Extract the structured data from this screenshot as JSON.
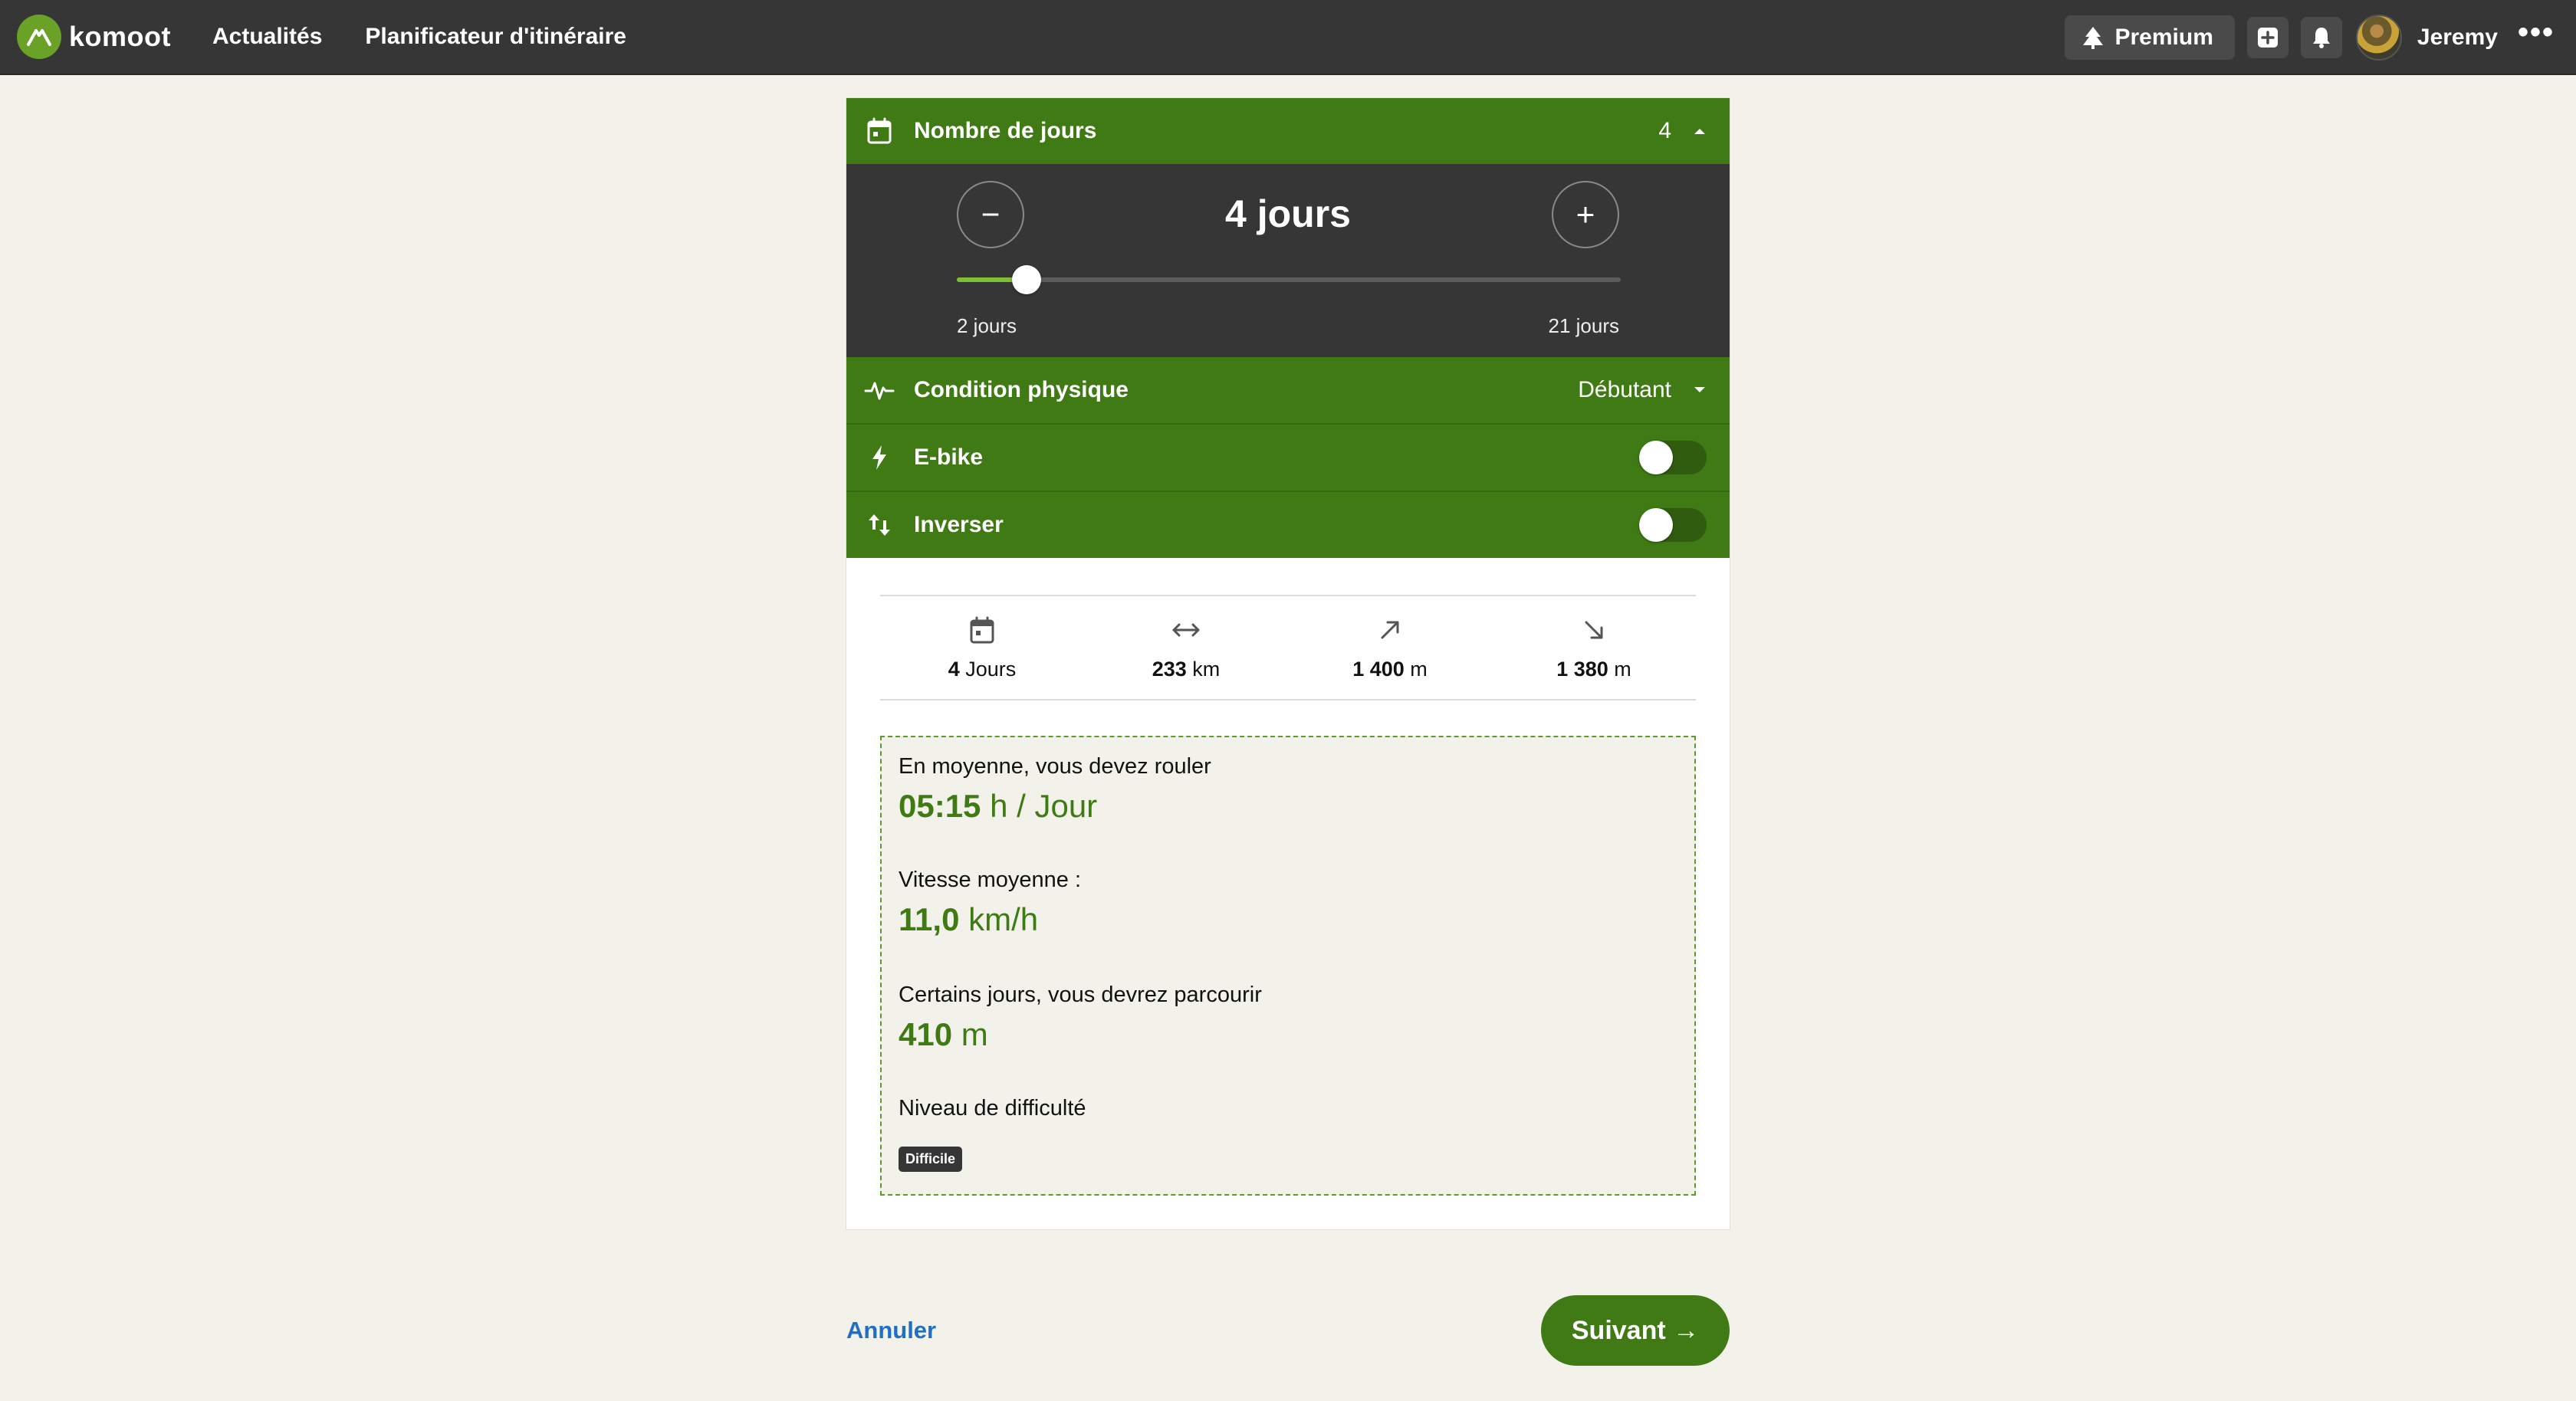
{
  "app": {
    "logo_text": "komoot",
    "nav": [
      {
        "label": "Actualités"
      },
      {
        "label": "Planificateur d'itinéraire"
      }
    ],
    "premium_label": "Premium",
    "username": "Jeremy",
    "more_label": "•••"
  },
  "days": {
    "header_label": "Nombre de jours",
    "header_value": "4",
    "title": "4 jours",
    "minus_label": "−",
    "plus_label": "+",
    "slider_min_label": "2 jours",
    "slider_max_label": "21 jours",
    "slider_min": 2,
    "slider_max": 21,
    "slider_value": 4
  },
  "options": {
    "fitness_label": "Condition physique",
    "fitness_value": "Débutant",
    "ebike_label": "E-bike",
    "ebike_on": false,
    "reverse_label": "Inverser",
    "reverse_on": false
  },
  "stats": [
    {
      "icon": "calendar-icon",
      "value": "4",
      "unit": "Jours"
    },
    {
      "icon": "distance-icon",
      "value": "233",
      "unit": "km"
    },
    {
      "icon": "elevation-up-icon",
      "value": "1 400",
      "unit": "m"
    },
    {
      "icon": "elevation-down-icon",
      "value": "1 380",
      "unit": "m"
    }
  ],
  "summary": {
    "ride_label": "En moyenne, vous devez rouler",
    "ride_value": "05:15",
    "ride_unit": "h / Jour",
    "speed_label": "Vitesse moyenne :",
    "speed_value": "11,0",
    "speed_unit": "km/h",
    "climb_label": "Certains jours, vous devrez parcourir",
    "climb_value": "410",
    "climb_unit": "m",
    "difficulty_label": "Niveau de difficulté",
    "difficulty_badge": "Difficile"
  },
  "actions": {
    "cancel_label": "Annuler",
    "next_label": "Suivant →"
  },
  "colors": {
    "brand_green": "#3f7a14",
    "dark_panel": "#363636",
    "link_blue": "#1f6fc2",
    "background": "#f3f2ea"
  }
}
